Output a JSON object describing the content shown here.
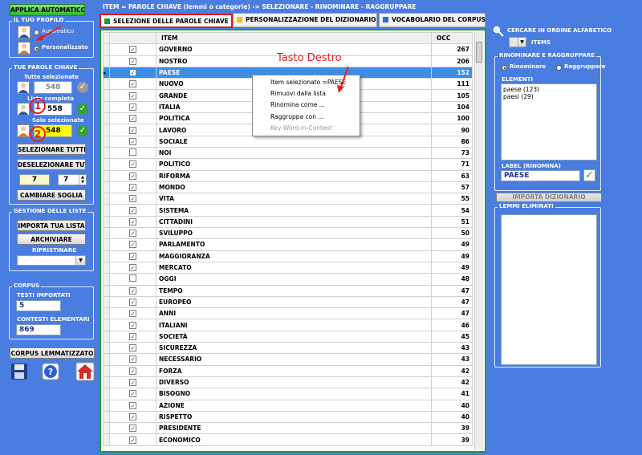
{
  "header": {
    "title": "ITEM = PAROLE CHIAVE (lemmi o categorie)  -> SELEZIONARE - RINOMINARE - RAGGRUPPARE"
  },
  "left": {
    "apply_label": "APPLICA AUTOMATICO",
    "profile": {
      "title": "IL TUO PROFILO",
      "option_auto": "Automatico",
      "option_custom": "Personalizzato",
      "selected": "Personalizzato"
    },
    "keywords": {
      "title": "TUE PAROLE CHIAVE",
      "all_label": "Tutte selezionate",
      "all_value": "548",
      "full_label": "Lista completa",
      "full_value": "558",
      "only_label": "Solo selezionate",
      "only_value": "548",
      "select_all": "SELEZIONARE TUTTI",
      "deselect_all": "DESELEZIONARE TUTTI",
      "threshold_a": "7",
      "threshold_b": "7",
      "change_threshold": "CAMBIARE SOGLIA"
    },
    "lists": {
      "title": "GESTIONE DELLE LISTE",
      "import": "IMPORTA TUA LISTA",
      "archive": "ARCHIVIARE",
      "restore": "RIPRISTINARE"
    },
    "corpus": {
      "title": "CORPUS",
      "texts_label": "TESTI IMPORTATI",
      "texts_value": "5",
      "contexts_label": "CONTESTI ELEMENTARI",
      "contexts_value": "869",
      "lemmatized": "CORPUS LEMMATIZZATO"
    },
    "markers": [
      "1",
      "2"
    ]
  },
  "tabs": [
    {
      "label": "SELEZIONE DELLE PAROLE CHIAVE",
      "color": "#1f9a3a"
    },
    {
      "label": "PERSONALIZZAZIONE DEL DIZIONARIO",
      "color": "#f2c200"
    },
    {
      "label": "VOCABOLARIO DEL CORPUS",
      "color": "#2a6fd6"
    }
  ],
  "grid": {
    "col_item": "ITEM",
    "col_occ": "OCC",
    "rows": [
      {
        "item": "GOVERNO",
        "occ": "267",
        "checked": true
      },
      {
        "item": "NOSTRO",
        "occ": "206",
        "checked": true
      },
      {
        "item": "PAESE",
        "occ": "152",
        "checked": true
      },
      {
        "item": "NUOVO",
        "occ": "111",
        "checked": true
      },
      {
        "item": "GRANDE",
        "occ": "105",
        "checked": true
      },
      {
        "item": "ITALIA",
        "occ": "104",
        "checked": true
      },
      {
        "item": "POLITICA",
        "occ": "100",
        "checked": true
      },
      {
        "item": "LAVORO",
        "occ": "90",
        "checked": true
      },
      {
        "item": "SOCIALE",
        "occ": "86",
        "checked": true
      },
      {
        "item": "NOI",
        "occ": "73",
        "checked": false
      },
      {
        "item": "POLITICO",
        "occ": "71",
        "checked": true
      },
      {
        "item": "RIFORMA",
        "occ": "63",
        "checked": true
      },
      {
        "item": "MONDO",
        "occ": "57",
        "checked": true
      },
      {
        "item": "VITA",
        "occ": "55",
        "checked": true
      },
      {
        "item": "SISTEMA",
        "occ": "54",
        "checked": true
      },
      {
        "item": "CITTADINI",
        "occ": "51",
        "checked": true
      },
      {
        "item": "SVILUPPO",
        "occ": "50",
        "checked": true
      },
      {
        "item": "PARLAMENTO",
        "occ": "49",
        "checked": true
      },
      {
        "item": "MAGGIORANZA",
        "occ": "49",
        "checked": true
      },
      {
        "item": "MERCATO",
        "occ": "49",
        "checked": true
      },
      {
        "item": "OGGI",
        "occ": "48",
        "checked": false
      },
      {
        "item": "TEMPO",
        "occ": "47",
        "checked": true
      },
      {
        "item": "EUROPEO",
        "occ": "47",
        "checked": true
      },
      {
        "item": "ANNI",
        "occ": "47",
        "checked": true
      },
      {
        "item": "ITALIANI",
        "occ": "46",
        "checked": true
      },
      {
        "item": "SOCIETÀ",
        "occ": "45",
        "checked": true
      },
      {
        "item": "SICUREZZA",
        "occ": "43",
        "checked": true
      },
      {
        "item": "NECESSARIO",
        "occ": "43",
        "checked": true
      },
      {
        "item": "FORZA",
        "occ": "42",
        "checked": true
      },
      {
        "item": "DIVERSO",
        "occ": "42",
        "checked": true
      },
      {
        "item": "BISOGNO",
        "occ": "41",
        "checked": true
      },
      {
        "item": "AZIONE",
        "occ": "40",
        "checked": true
      },
      {
        "item": "RISPETTO",
        "occ": "40",
        "checked": true
      },
      {
        "item": "PRESIDENTE",
        "occ": "39",
        "checked": true
      },
      {
        "item": "ECONOMICO",
        "occ": "39",
        "checked": true
      }
    ],
    "selected_row": "PAESE"
  },
  "context_menu": {
    "items": [
      {
        "label": "Item selezionato =PAESE",
        "disabled": false
      },
      {
        "label": "Rimuovi dalla lista",
        "disabled": false
      },
      {
        "label": "Rinomina come ...",
        "disabled": false
      },
      {
        "label": "Raggruppa con ...",
        "disabled": false
      },
      {
        "label": "Key-Word-in-Context",
        "disabled": true
      }
    ]
  },
  "annotation": "Tasto Destro",
  "right": {
    "search_label": "CERCARE IN ORDINE ALFABETICO",
    "items_label": "ITEMS",
    "rename_group": {
      "title": "RINOMINARE E RAGGRUPPARE",
      "opt_rename": "Rinominare",
      "opt_group": "Raggruppare",
      "selected": "Rinominare",
      "elements_label": "ELEMENTI",
      "elements": [
        "paese (123)",
        "paesi (29)"
      ],
      "label_title": "LABEL (RINOMINA)",
      "label_value": "PAESE"
    },
    "import_dict": "IMPORTA DIZIONARIO",
    "removed_title": "LEMMI ELIMINATI"
  }
}
